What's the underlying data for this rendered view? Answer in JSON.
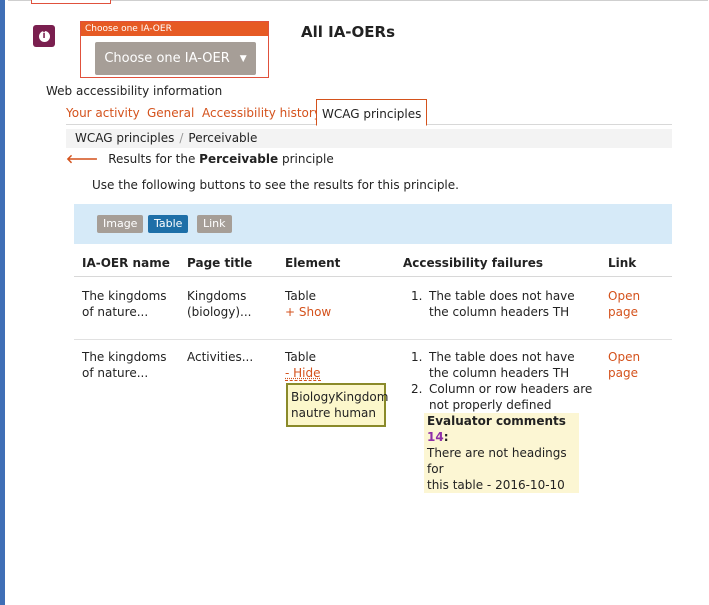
{
  "top_select": {
    "header": "Choose one IA-OER",
    "button_label": "Choose one IA-OER",
    "caret_icon": "caret-down-icon",
    "info_icon": "info-icon"
  },
  "page_title": "All IA-OERs",
  "section_label": "Web accessibility information",
  "tabs": [
    {
      "label": "Your activity",
      "active": false
    },
    {
      "label": "General",
      "active": false
    },
    {
      "label": "Accessibility history",
      "active": false
    },
    {
      "label": "WCAG principles",
      "active": true
    }
  ],
  "breadcrumb": {
    "parent": "WCAG principles",
    "separator": "/",
    "current": "Perceivable"
  },
  "results": {
    "prefix": "Results for the ",
    "principle": "Perceivable",
    "suffix": " principle",
    "back_icon": "back-arrow-icon"
  },
  "instructions": "Use the following buttons to see the results for this principle.",
  "filter_buttons": [
    {
      "label": "Image",
      "active": false
    },
    {
      "label": "Table",
      "active": true
    },
    {
      "label": "Link",
      "active": false
    }
  ],
  "table": {
    "headers": [
      "IA-OER name",
      "Page title",
      "Element",
      "Accessibility failures",
      "Link"
    ],
    "rows": [
      {
        "name_l1": "The kingdoms",
        "name_l2": "of nature...",
        "title_l1": "Kingdoms",
        "title_l2": "(biology)...",
        "element": "Table",
        "toggle": "+ Show",
        "failures": [
          {
            "num": "1.",
            "l1": "The table does not have",
            "l2": "the column headers TH"
          }
        ],
        "link_l1": "Open",
        "link_l2": "page"
      },
      {
        "name_l1": "The kingdoms",
        "name_l2": "of nature...",
        "title_l1": "Activities...",
        "element": "Table",
        "toggle": "- Hide",
        "failures": [
          {
            "num": "1.",
            "l1": "The table does not have",
            "l2": "the column headers TH"
          },
          {
            "num": "2.",
            "l1": "Column or row headers are",
            "l2": "not properly defined"
          }
        ],
        "evaluator_label": "Evaluator comments",
        "evaluator_count": "14",
        "evaluator_colon": ":",
        "evaluator_text_l1": "There are not headings for",
        "evaluator_text_l2": "this table - 2016-10-10",
        "link_l1": "Open",
        "link_l2": "page"
      }
    ]
  },
  "tooltip": {
    "l1": "BiologyKingdom",
    "l2": "nautre  human"
  }
}
